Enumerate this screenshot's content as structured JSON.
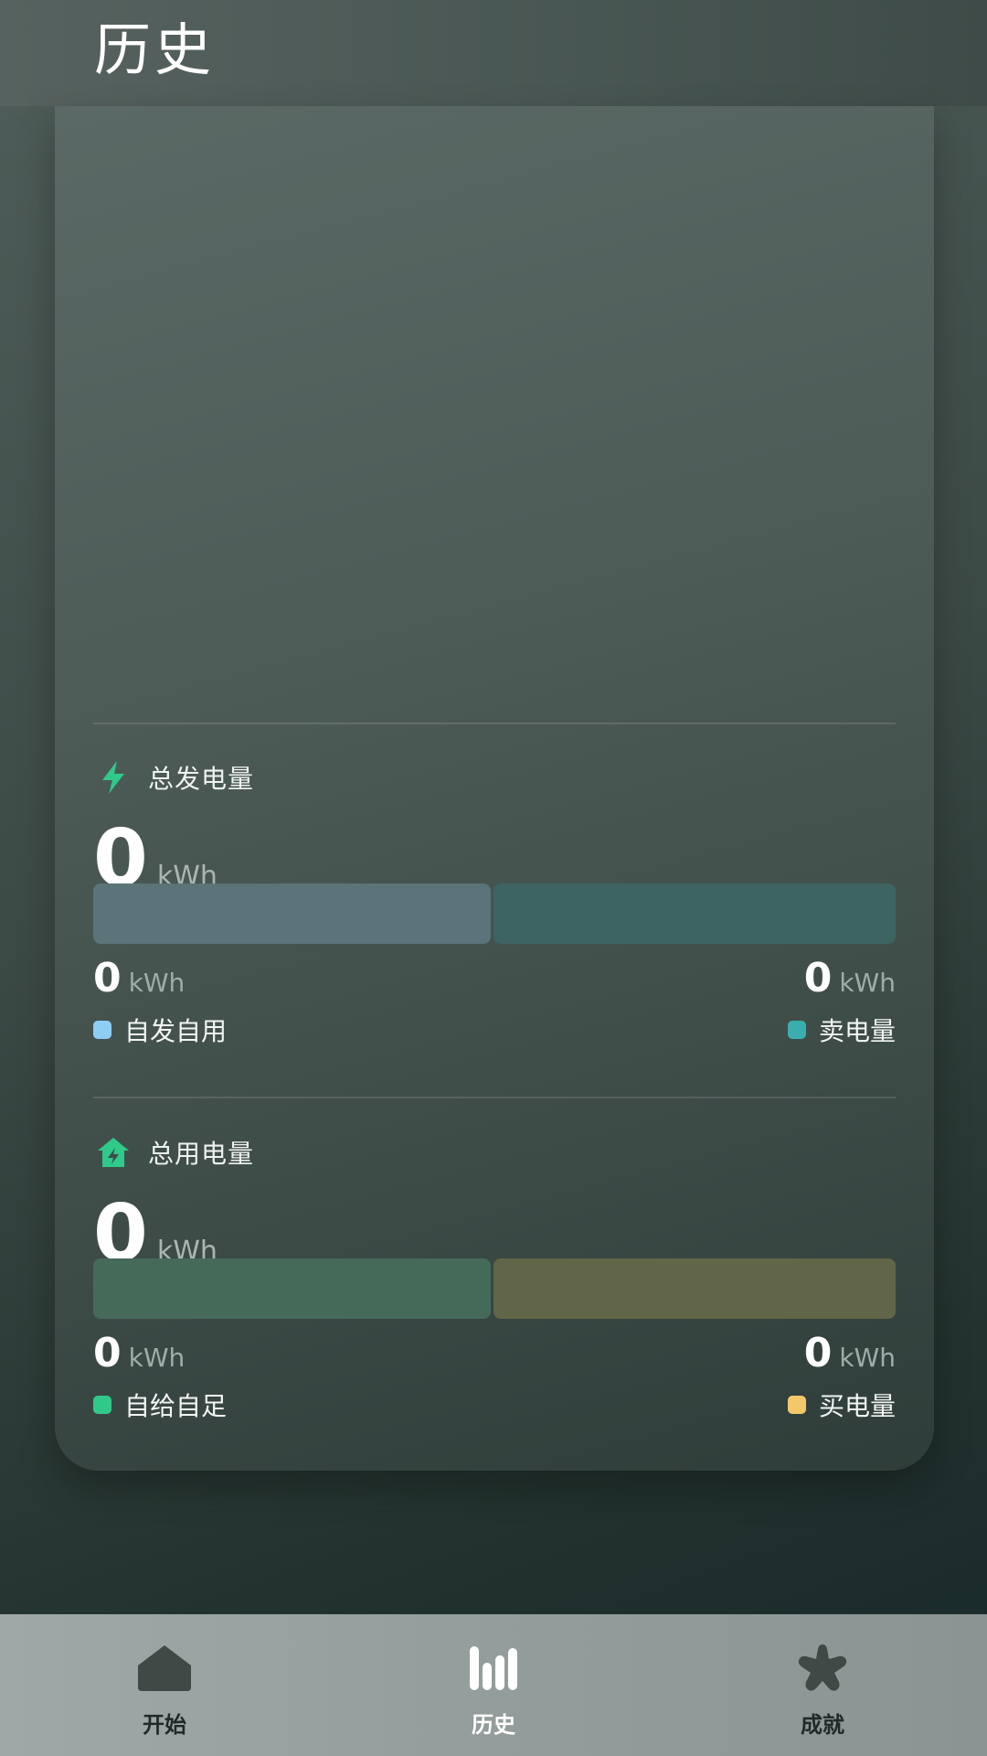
{
  "header": {
    "title": "历史"
  },
  "generation": {
    "title": "总发电量",
    "icon": "lightning-icon",
    "total": {
      "value": "0",
      "unit": "kWh"
    },
    "left": {
      "value": "0",
      "unit": "kWh",
      "label": "自发自用",
      "color": "#8ecdf5",
      "bar_color": "#5a7479"
    },
    "right": {
      "value": "0",
      "unit": "kWh",
      "label": "卖电量",
      "color": "#3aaeae",
      "bar_color": "#3d6463"
    }
  },
  "consumption": {
    "title": "总用电量",
    "icon": "home-energy-icon",
    "total": {
      "value": "0",
      "unit": "kWh"
    },
    "left": {
      "value": "0",
      "unit": "kWh",
      "label": "自给自足",
      "color": "#2fc98a",
      "bar_color": "#456a5a"
    },
    "right": {
      "value": "0",
      "unit": "kWh",
      "label": "买电量",
      "color": "#f3c86a",
      "bar_color": "#616648"
    }
  },
  "tabs": [
    {
      "label": "开始",
      "icon": "home-icon",
      "active": false
    },
    {
      "label": "历史",
      "icon": "bar-chart-icon",
      "active": true
    },
    {
      "label": "成就",
      "icon": "star-icon",
      "active": false
    }
  ],
  "colors": {
    "accent": "#2fc98a",
    "tab_inactive": "#3f4a47",
    "tab_active": "#ffffff"
  }
}
